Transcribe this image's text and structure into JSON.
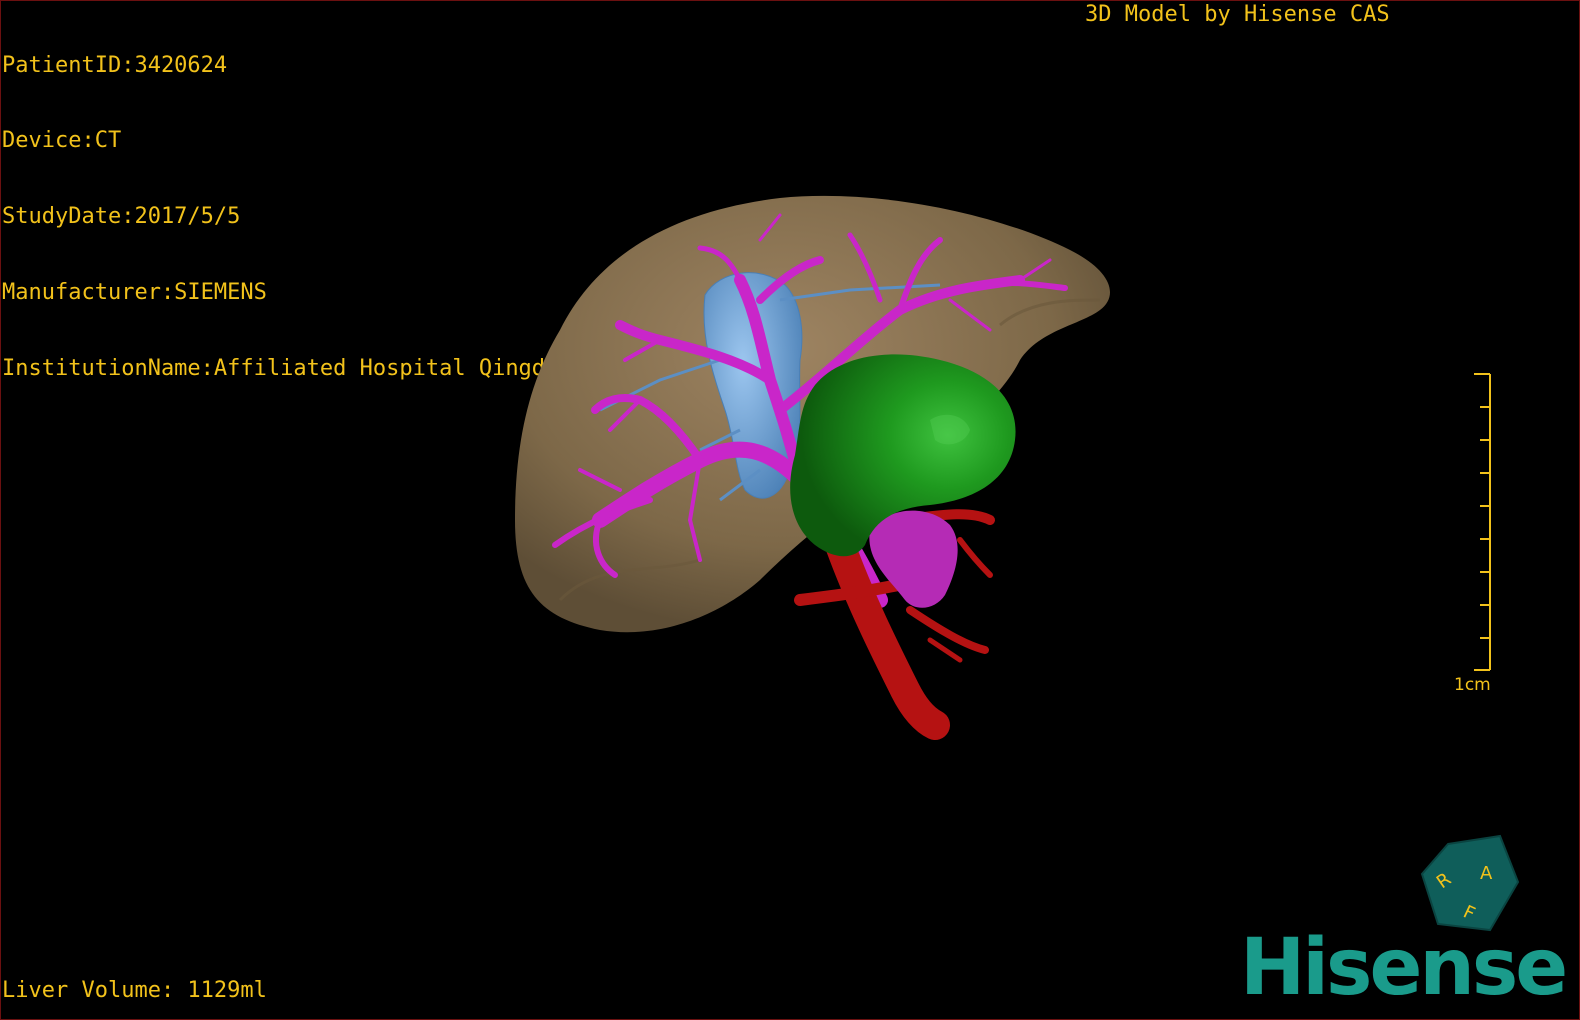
{
  "overlay": {
    "patient_id": "PatientID:3420624",
    "device": "Device:CT",
    "study_date": "StudyDate:2017/5/5",
    "manufacturer": "Manufacturer:SIEMENS",
    "institution": "InstitutionName:Affiliated Hospital Qingdao University-C",
    "model_credit": "3D Model by Hisense CAS",
    "liver_volume": "Liver Volume: 1129ml"
  },
  "scale": {
    "label": "1cm",
    "ticks": 10
  },
  "orientation_cube": {
    "labels": [
      "R",
      "A",
      "F"
    ],
    "color": "#0f5e5a"
  },
  "brand": {
    "logo_text": "Hisense",
    "color": "#1a9b8b"
  },
  "colors": {
    "overlay_text": "#f2c21b",
    "liver": "#8a7352",
    "portal_vein": "#c926c9",
    "hepatic_vein": "#6fa8dc",
    "tumor": "#1c8a1c",
    "artery": "#b51212"
  }
}
